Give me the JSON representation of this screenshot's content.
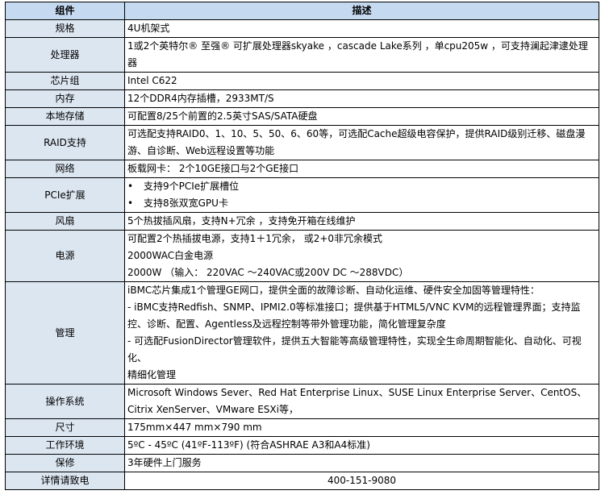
{
  "header": {
    "col1": "组件",
    "col2": "描述"
  },
  "rows": [
    {
      "label": "规格",
      "lines": [
        "4U机架式"
      ]
    },
    {
      "label": "处理器",
      "lines": [
        "1或2个英特尔® 至强® 可扩展处理器skyake ，cascade  Lake系列 ，单cpu205w ，可支持澜起津逮处理器"
      ]
    },
    {
      "label": "芯片组",
      "lines": [
        "Intel C622"
      ]
    },
    {
      "label": "内存",
      "lines": [
        "12个DDR4内存插槽，2933MT/S"
      ]
    },
    {
      "label": "本地存储",
      "lines": [
        "可配置8/25个前置的2.5英寸SAS/SATA硬盘"
      ]
    },
    {
      "label": "RAID支持",
      "lines": [
        "可选配支持RAID0、1、10、5、50、6、60等，可选配Cache超级电容保护，提供RAID级别迁移、磁盘漫游、自诊断、Web远程设置等功能"
      ]
    },
    {
      "label": "网络",
      "lines": [
        "板载网卡： 2个10GE接口与2个GE接口"
      ]
    },
    {
      "label": "PCIe扩展",
      "bullets": [
        "支持9个PCIe扩展槽位",
        "支持8张双宽GPU卡"
      ]
    },
    {
      "label": "风扇",
      "lines": [
        "5个热拔插风扇，支持N+冗余 ，支持免开箱在线维护"
      ]
    },
    {
      "label": "电源",
      "lines": [
        "可配置2个热插拔电源，支持1＋1冗余， 或2+0非冗余模式",
        "2000WAC白金电源",
        "2000W （输入： 220VAC ～240VAC或200V DC ～288VDC）"
      ]
    },
    {
      "label": "管理",
      "lines": [
        "iBMC芯片集成1个管理GE网口，提供全面的故障诊断、自动化运维、硬件安全加固等管理特性：",
        "- iBMC支持Redfish、SNMP、IPMI2.0等标准接口；提供基于HTML5/VNC KVM的远程管理界面；支持监控、诊断、配置、Agentless及远程控制等带外管理功能，简化管理复杂度",
        "- 可选配FusionDirector管理软件，提供五大智能等高级管理特性，实现全生命周期智能化、自动化、可视化、",
        "精细化管理"
      ]
    },
    {
      "label": "操作系统",
      "lines": [
        "Microsoft Windows Sever、Red Hat Enterprise Linux、SUSE Linux Enterprise Server、CentOS、Citrix XenServer、VMware ESXi等，"
      ]
    },
    {
      "label": "尺寸",
      "lines": [
        "175mm×447 mm×790 mm"
      ]
    },
    {
      "label": "工作环境",
      "lines": [
        "5ºC - 45ºC (41ºF-113ºF) (符合ASHRAE A3和A4标准)"
      ]
    },
    {
      "label": "保修",
      "lines": [
        "3年硬件上门服务"
      ]
    },
    {
      "label": "详情请致电",
      "lines": [
        "400-151-9080"
      ]
    }
  ]
}
